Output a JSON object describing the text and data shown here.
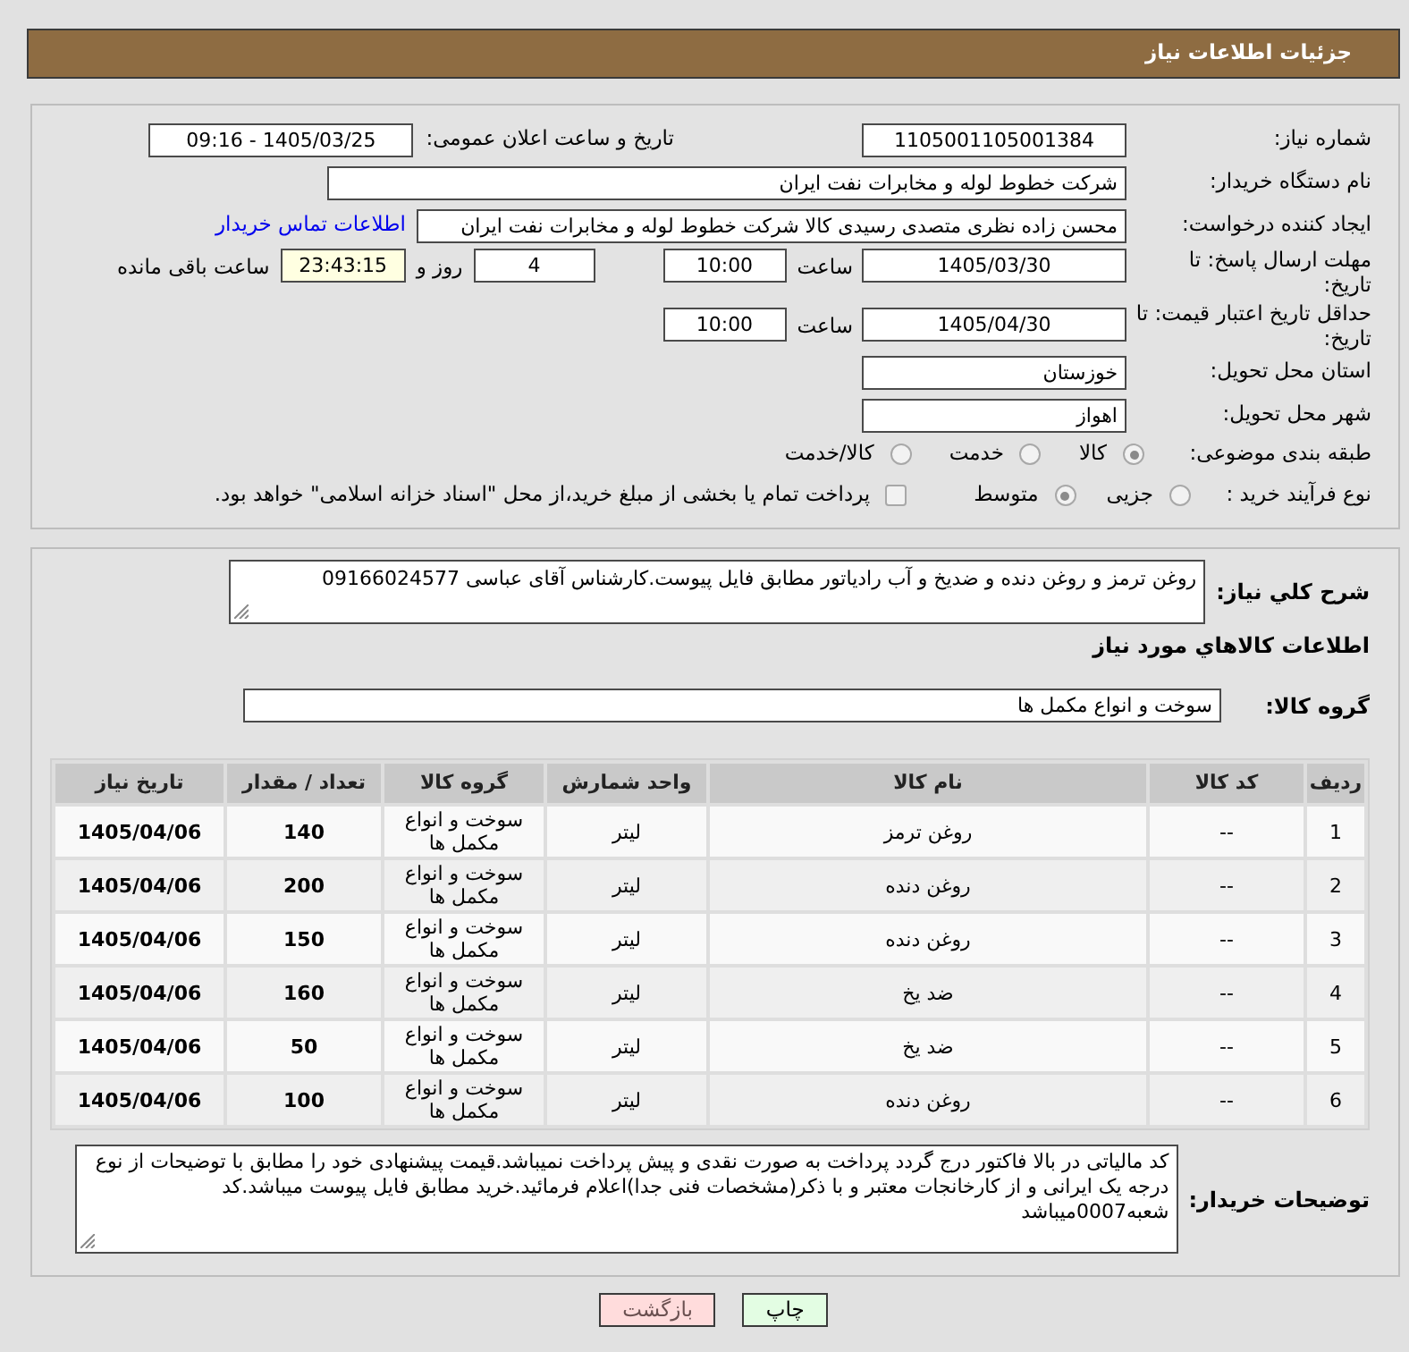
{
  "header": {
    "title": "جزئیات اطلاعات نیاز"
  },
  "need_number": {
    "label": "شماره نیاز:",
    "value": "1105001105001384"
  },
  "announce": {
    "label": "تاریخ و ساعت اعلان عمومی:",
    "value": "1405/03/25 - 09:16"
  },
  "buyer_org": {
    "label": "نام دستگاه خریدار:",
    "value": "شرکت خطوط لوله و مخابرات نفت ایران"
  },
  "requester": {
    "label": "ایجاد کننده درخواست:",
    "value": "محسن زاده نظری متصدی رسیدی کالا شرکت خطوط لوله و مخابرات نفت ایران",
    "link": "اطلاعات تماس خریدار"
  },
  "response_deadline": {
    "label": "مهلت ارسال پاسخ: تا تاریخ:",
    "date": "1405/03/30",
    "time_label": "ساعت",
    "time": "10:00",
    "days": "4",
    "days_label": "روز و",
    "remaining": "23:43:15",
    "remaining_label": "ساعت باقی مانده"
  },
  "price_validity": {
    "label": "حداقل تاریخ اعتبار قیمت: تا تاریخ:",
    "date": "1405/04/30",
    "time_label": "ساعت",
    "time": "10:00"
  },
  "province": {
    "label": "استان محل تحویل:",
    "value": "خوزستان"
  },
  "city": {
    "label": "شهر محل تحویل:",
    "value": "اهواز"
  },
  "category": {
    "label": "طبقه بندی موضوعی:",
    "options": [
      {
        "label": "کالا",
        "selected": true
      },
      {
        "label": "خدمت",
        "selected": false
      },
      {
        "label": "کالا/خدمت",
        "selected": false
      }
    ]
  },
  "process": {
    "label": "نوع فرآیند خرید :",
    "options": [
      {
        "label": "جزیی",
        "selected": false
      },
      {
        "label": "متوسط",
        "selected": true
      }
    ],
    "treasury": {
      "label": "پرداخت تمام یا بخشی از مبلغ خرید،از محل \"اسناد خزانه اسلامی\" خواهد بود.",
      "checked": false
    }
  },
  "description": {
    "label": "شرح کلي نياز:",
    "value": "روغن ترمز و روغن دنده و ضدیخ و آب رادیاتور مطابق فایل پیوست.کارشناس آقای عباسی 09166024577"
  },
  "goods_title": "اطلاعات کالاهاي مورد نياز",
  "goods_group": {
    "label": "گروه کالا:",
    "value": "سوخت و انواع مکمل ها"
  },
  "table": {
    "columns": [
      "ردیف",
      "کد کالا",
      "نام کالا",
      "واحد شمارش",
      "گروه کالا",
      "تعداد / مقدار",
      "تاریخ نیاز"
    ],
    "rows": [
      [
        "1",
        "--",
        "روغن ترمز",
        "لیتر",
        "سوخت و انواع مکمل ها",
        "140",
        "1405/04/06"
      ],
      [
        "2",
        "--",
        "روغن دنده",
        "لیتر",
        "سوخت و انواع مکمل ها",
        "200",
        "1405/04/06"
      ],
      [
        "3",
        "--",
        "روغن دنده",
        "لیتر",
        "سوخت و انواع مکمل ها",
        "150",
        "1405/04/06"
      ],
      [
        "4",
        "--",
        "ضد یخ",
        "لیتر",
        "سوخت و انواع مکمل ها",
        "160",
        "1405/04/06"
      ],
      [
        "5",
        "--",
        "ضد یخ",
        "لیتر",
        "سوخت و انواع مکمل ها",
        "50",
        "1405/04/06"
      ],
      [
        "6",
        "--",
        "روغن دنده",
        "لیتر",
        "سوخت و انواع مکمل ها",
        "100",
        "1405/04/06"
      ]
    ]
  },
  "buyer_notes": {
    "label": "توضیحات خریدار:",
    "value": "کد مالیاتی در بالا فاکتور درج گردد پرداخت به صورت نقدی و پیش پرداخت نمیباشد.قیمت پیشنهادی خود را مطابق با توضیحات از نوع درجه یک ایرانی و از کارخانجات معتبر و با ذکر(مشخصات فنی جدا)اعلام فرمائید.خرید مطابق فایل پیوست میباشد.کد شعبه0007میباشد"
  },
  "buttons": [
    {
      "label": "چاپ",
      "kind": "print"
    },
    {
      "label": "بازگشت",
      "kind": "back"
    }
  ]
}
